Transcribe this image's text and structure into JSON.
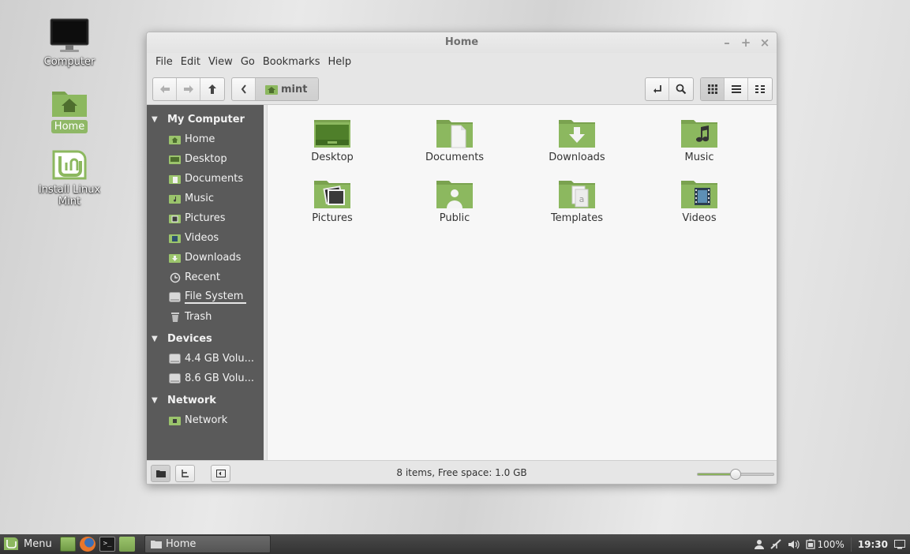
{
  "desktop": {
    "icons": [
      {
        "label": "Computer",
        "icon": "computer-monitor-icon"
      },
      {
        "label": "Home",
        "icon": "home-folder-icon",
        "selected": true
      },
      {
        "label": "Install Linux Mint",
        "icon": "linux-mint-logo-icon"
      }
    ]
  },
  "window": {
    "title": "Home",
    "controls": {
      "minimize": "–",
      "maximize": "+",
      "close": "×"
    },
    "menu": [
      "File",
      "Edit",
      "View",
      "Go",
      "Bookmarks",
      "Help"
    ],
    "toolbar": {
      "back": "back-arrow-icon",
      "forward": "forward-arrow-icon",
      "up": "up-arrow-icon",
      "path_toggle": "chevron-left-icon",
      "path_current": "mint",
      "location_toggle": "return-arrow-icon",
      "search": "search-icon",
      "view_modes": [
        "icon-view",
        "list-view",
        "compact-view"
      ],
      "active_view": "icon-view"
    },
    "sidebar": {
      "sections": [
        {
          "title": "My Computer",
          "items": [
            {
              "label": "Home",
              "icon": "home-folder-icon"
            },
            {
              "label": "Desktop",
              "icon": "desktop-folder-icon"
            },
            {
              "label": "Documents",
              "icon": "documents-folder-icon"
            },
            {
              "label": "Music",
              "icon": "music-folder-icon"
            },
            {
              "label": "Pictures",
              "icon": "pictures-folder-icon"
            },
            {
              "label": "Videos",
              "icon": "videos-folder-icon"
            },
            {
              "label": "Downloads",
              "icon": "downloads-folder-icon"
            },
            {
              "label": "Recent",
              "icon": "recent-clock-icon"
            },
            {
              "label": "File System",
              "icon": "drive-icon"
            },
            {
              "label": "Trash",
              "icon": "trash-icon"
            }
          ]
        },
        {
          "title": "Devices",
          "items": [
            {
              "label": "4.4 GB Volu...",
              "icon": "drive-icon"
            },
            {
              "label": "8.6 GB Volu...",
              "icon": "drive-icon"
            }
          ]
        },
        {
          "title": "Network",
          "items": [
            {
              "label": "Network",
              "icon": "network-folder-icon"
            }
          ]
        }
      ]
    },
    "files": [
      {
        "label": "Desktop",
        "icon": "desktop-folder-icon"
      },
      {
        "label": "Documents",
        "icon": "documents-folder-icon"
      },
      {
        "label": "Downloads",
        "icon": "downloads-folder-icon"
      },
      {
        "label": "Music",
        "icon": "music-folder-icon"
      },
      {
        "label": "Pictures",
        "icon": "pictures-folder-icon"
      },
      {
        "label": "Public",
        "icon": "public-folder-icon"
      },
      {
        "label": "Templates",
        "icon": "templates-folder-icon"
      },
      {
        "label": "Videos",
        "icon": "videos-folder-icon"
      }
    ],
    "statusbar": {
      "text": "8 items, Free space: 1.0 GB",
      "zoom_fraction": 0.5
    }
  },
  "taskbar": {
    "menu_label": "Menu",
    "launchers": [
      "show-desktop-icon",
      "firefox-icon",
      "terminal-icon",
      "files-icon"
    ],
    "task_label": "Home",
    "tray": {
      "battery": "100%",
      "clock": "19:30"
    }
  },
  "colors": {
    "accent": "#8ab15c",
    "folder": "#8cb85f",
    "sidebar": "#5a5a5a"
  }
}
